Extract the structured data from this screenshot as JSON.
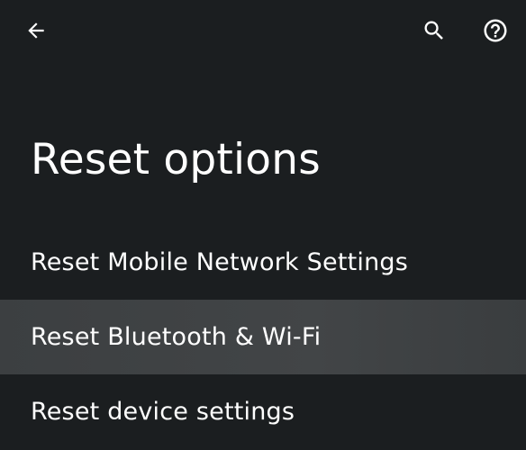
{
  "header": {
    "back_icon": "arrow-left-icon",
    "search_icon": "search-icon",
    "help_icon": "help-circle-icon"
  },
  "page": {
    "title": "Reset options"
  },
  "options": [
    {
      "label": "Reset Mobile Network Settings",
      "highlighted": false
    },
    {
      "label": "Reset Bluetooth & Wi-Fi",
      "highlighted": true
    },
    {
      "label": "Reset device settings",
      "highlighted": false
    }
  ],
  "colors": {
    "background": "#1b1e20",
    "highlight": "#404345",
    "text": "#ffffff"
  }
}
